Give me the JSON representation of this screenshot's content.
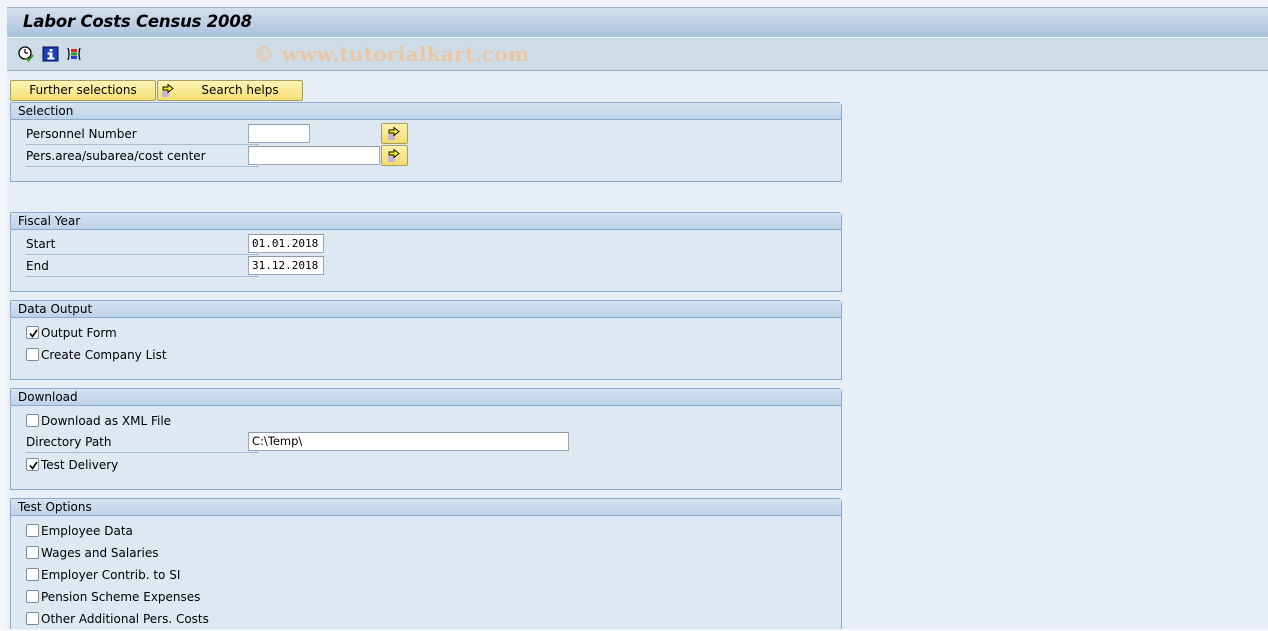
{
  "window": {
    "title": "Labor Costs Census 2008",
    "watermark": "© www.tutorialkart.com"
  },
  "toolbar": {
    "icons": [
      {
        "name": "execute-clock-icon",
        "tooltip": ""
      },
      {
        "name": "info-icon",
        "tooltip": ""
      },
      {
        "name": "selection-options-icon",
        "tooltip": ""
      }
    ]
  },
  "buttons": {
    "further_selections": "Further selections",
    "search_helps": "Search helps"
  },
  "groups": {
    "selection": {
      "title": "Selection",
      "fields": [
        {
          "label": "Personnel Number",
          "value": ""
        },
        {
          "label": "Pers.area/subarea/cost center",
          "value": ""
        }
      ]
    },
    "fiscal_year": {
      "title": "Fiscal Year",
      "fields": [
        {
          "label": "Start",
          "value": "01.01.2018"
        },
        {
          "label": "End",
          "value": "31.12.2018"
        }
      ]
    },
    "data_output": {
      "title": "Data Output",
      "options": [
        {
          "label": "Output Form",
          "checked": true
        },
        {
          "label": "Create Company List",
          "checked": false
        }
      ]
    },
    "download": {
      "title": "Download",
      "xml_option": {
        "label": "Download as XML File",
        "checked": false
      },
      "directory": {
        "label": "Directory Path",
        "value": "C:\\Temp\\"
      },
      "test_delivery": {
        "label": "Test Delivery",
        "checked": true
      }
    },
    "test_options": {
      "title": "Test Options",
      "options": [
        {
          "label": "Employee Data",
          "checked": false
        },
        {
          "label": "Wages and Salaries",
          "checked": false
        },
        {
          "label": "Employer Contrib. to SI",
          "checked": false
        },
        {
          "label": "Pension Scheme Expenses",
          "checked": false
        },
        {
          "label": "Other Additional Pers. Costs",
          "checked": false
        }
      ]
    }
  }
}
